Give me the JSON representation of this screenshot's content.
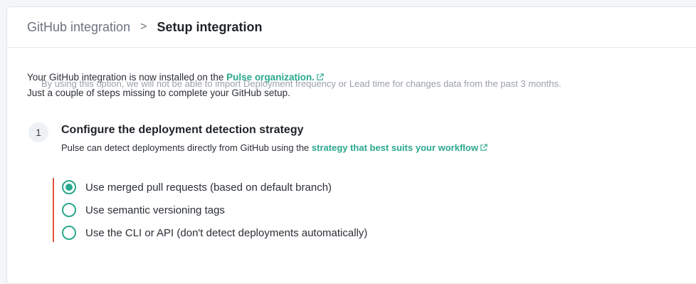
{
  "breadcrumb": {
    "parent": "GitHub integration",
    "separator": ">",
    "current": "Setup integration"
  },
  "intro": {
    "line1_prefix": "Your GitHub integration is now installed on the ",
    "line1_link": "Pulse organization.",
    "line2": "Just a couple of steps missing to complete your GitHub setup."
  },
  "step": {
    "number": "1",
    "title": "Configure the deployment detection strategy",
    "desc_prefix": "Pulse can detect deployments directly from GitHub using the ",
    "desc_link": "strategy that best suits your workflow"
  },
  "options": [
    {
      "label": "Use merged pull requests (based on default branch)",
      "selected": true
    },
    {
      "label": "Use semantic versioning tags",
      "selected": false
    },
    {
      "label": "Use the CLI or API (don't detect deployments automatically)",
      "selected": false
    }
  ],
  "option_help": "By using this option, we will not be able to import Deployment frequency or Lead time for changes data from the past 3 months.",
  "colors": {
    "accent": "#2aa88c",
    "error_bar": "#e2553a",
    "muted": "#9aa0a8"
  },
  "icons": {
    "external": "external-link-icon",
    "chevron": "chevron-right-icon"
  }
}
